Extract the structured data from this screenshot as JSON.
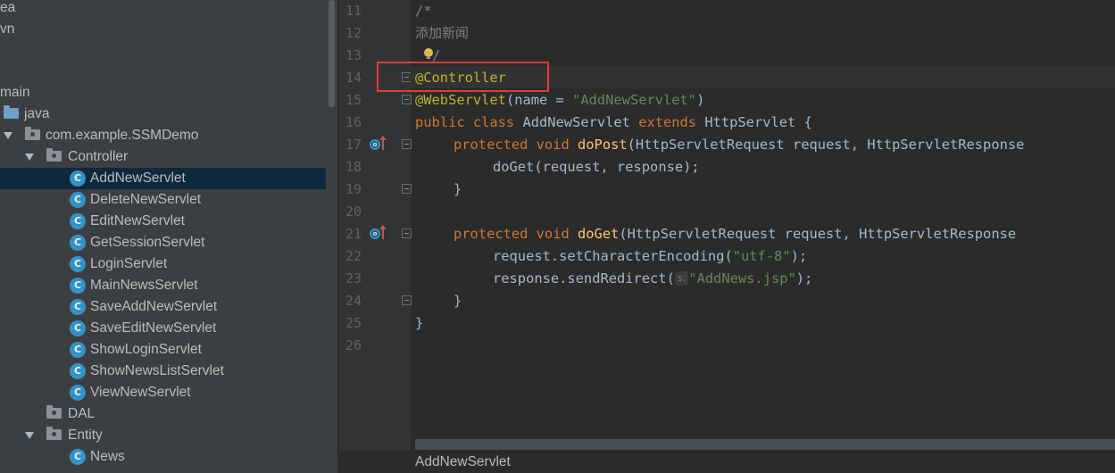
{
  "tree": {
    "items": [
      {
        "label": "ea"
      },
      {
        "label": "vn"
      },
      {
        "label": "main"
      },
      {
        "label": "java"
      },
      {
        "label": "com.example.SSMDemo"
      },
      {
        "label": "Controller"
      },
      {
        "label": "AddNewServlet",
        "icon_letter": "C",
        "selected": true
      },
      {
        "label": "DeleteNewServlet",
        "icon_letter": "C"
      },
      {
        "label": "EditNewServlet",
        "icon_letter": "C"
      },
      {
        "label": "GetSessionServlet",
        "icon_letter": "C"
      },
      {
        "label": "LoginServlet",
        "icon_letter": "C"
      },
      {
        "label": "MainNewsServlet",
        "icon_letter": "C"
      },
      {
        "label": "SaveAddNewServlet",
        "icon_letter": "C"
      },
      {
        "label": "SaveEditNewServlet",
        "icon_letter": "C"
      },
      {
        "label": "ShowLoginServlet",
        "icon_letter": "C"
      },
      {
        "label": "ShowNewsListServlet",
        "icon_letter": "C"
      },
      {
        "label": "ViewNewServlet",
        "icon_letter": "C"
      },
      {
        "label": "DAL"
      },
      {
        "label": "Entity"
      },
      {
        "label": "News",
        "icon_letter": "C"
      }
    ]
  },
  "gutter": {
    "lines": [
      "11",
      "12",
      "13",
      "14",
      "15",
      "16",
      "17",
      "18",
      "19",
      "20",
      "21",
      "22",
      "23",
      "24",
      "25",
      "26"
    ],
    "override_icon_letter": "o"
  },
  "code": {
    "line11": "/*",
    "line12": "添加新闻",
    "line13": "/",
    "line14_ann": "@Controller",
    "line15": {
      "ann": "@WebServlet",
      "open": "(name = ",
      "str": "\"AddNewServlet\"",
      "close": ")"
    },
    "line16": {
      "kw1": "public class",
      "name": " AddNewServlet ",
      "kw2": "extends",
      "rest": " HttpServlet {"
    },
    "line17": {
      "kw": "protected void",
      "fn": "doPost",
      "rest": "(HttpServletRequest request, HttpServletResponse"
    },
    "line18": "doGet(request, response);",
    "line19": "}",
    "line21": {
      "kw": "protected void",
      "fn": "doGet",
      "rest": "(HttpServletRequest request, HttpServletResponse"
    },
    "line22": {
      "pre": "request.setCharacterEncoding(",
      "str": "\"utf-8\"",
      "post": ");"
    },
    "line23": {
      "pre": "response.sendRedirect(",
      "hint": "s:",
      "str": "\"AddNews.jsp\"",
      "post": ");"
    },
    "line24": "}",
    "line25": "}"
  },
  "status": {
    "breadcrumb": "AddNewServlet"
  },
  "colors": {
    "keyword": "#cc7832",
    "annotation": "#bbb529",
    "string": "#6a8759",
    "method": "#ffc66d",
    "comment": "#808080",
    "highlight_box": "#e53935",
    "selection": "#0d293e"
  }
}
